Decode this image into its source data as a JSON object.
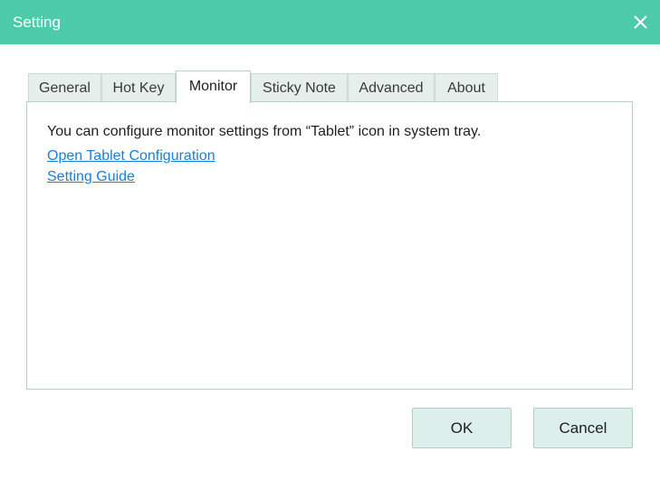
{
  "window": {
    "title": "Setting"
  },
  "tabs": [
    {
      "label": "General",
      "active": false
    },
    {
      "label": "Hot Key",
      "active": false
    },
    {
      "label": "Monitor",
      "active": true
    },
    {
      "label": "Sticky Note",
      "active": false
    },
    {
      "label": "Advanced",
      "active": false
    },
    {
      "label": "About",
      "active": false
    }
  ],
  "monitor_panel": {
    "description": "You can configure monitor settings from “Tablet” icon in system tray.",
    "links": [
      {
        "label": "Open Tablet Configuration"
      },
      {
        "label": "Setting Guide"
      }
    ]
  },
  "buttons": {
    "ok_label": "OK",
    "cancel_label": "Cancel"
  },
  "colors": {
    "titlebar": "#4ccaa9",
    "link": "#1a7fd8",
    "button_bg": "#dcefea"
  },
  "icons": {
    "close": "close-icon"
  }
}
